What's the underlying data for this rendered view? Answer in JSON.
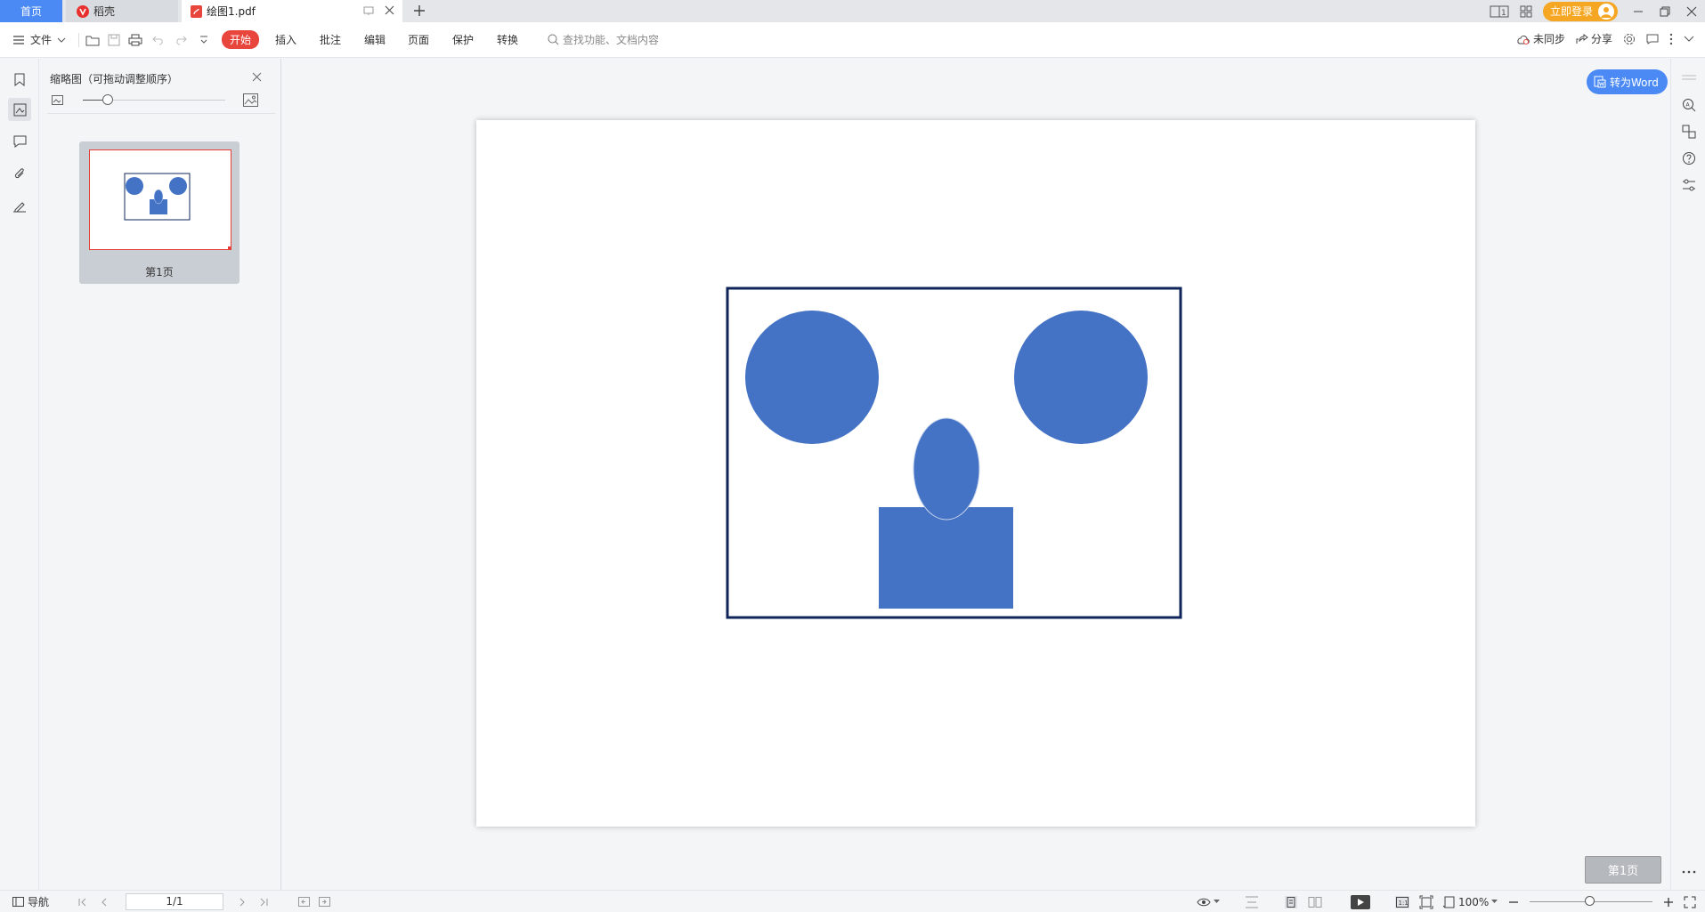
{
  "tabs": {
    "home": "首页",
    "docer": "稻壳",
    "file": "绘图1.pdf"
  },
  "titlebar": {
    "login_label": "立即登录"
  },
  "menu": {
    "file_label": "文件",
    "tabs": [
      "开始",
      "插入",
      "批注",
      "编辑",
      "页面",
      "保护",
      "转换"
    ],
    "active_tab": "开始",
    "search_placeholder": "查找功能、文档内容",
    "sync_label": "未同步",
    "share_label": "分享"
  },
  "thumbnail_panel": {
    "title": "缩略图（可拖动调整顺序）",
    "page_label": "第1页"
  },
  "document": {
    "to_word_label": "转为Word",
    "current_page_badge": "第1页",
    "drawing": {
      "frame_color": "#0f2559",
      "shape_color": "#4472c4",
      "shapes": [
        "circle-left",
        "circle-right",
        "ellipse-center",
        "rectangle-bottom"
      ]
    }
  },
  "statusbar": {
    "nav_label": "导航",
    "page_indicator": "1/1",
    "zoom_level": "100%"
  },
  "colors": {
    "accent": "#4b8af5",
    "active_tab": "#e8453c",
    "login": "#f5a623"
  }
}
